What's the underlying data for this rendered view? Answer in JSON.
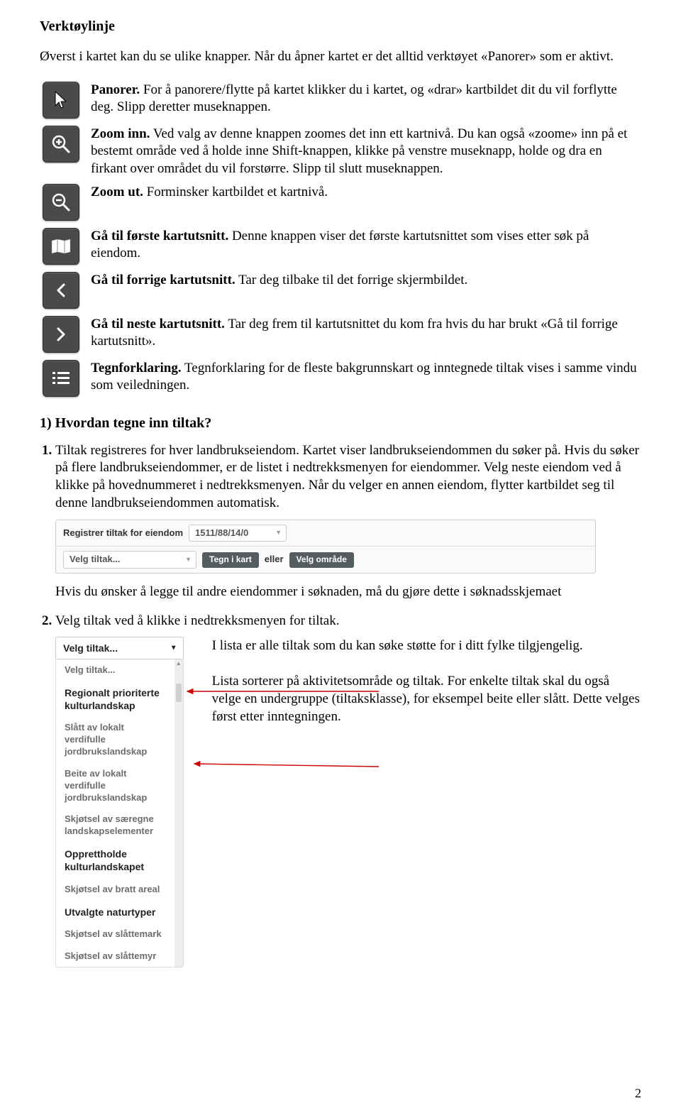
{
  "title": "Verktøylinje",
  "intro": "Øverst i kartet kan du se ulike knapper. Når du åpner kartet er det alltid verktøyet «Panorer» som er aktivt.",
  "tools": [
    {
      "name": "Panorer.",
      "text": " For å panorere/flytte på kartet klikker du i kartet, og «drar» kartbildet dit du vil forflytte deg. Slipp deretter museknappen."
    },
    {
      "name": "Zoom inn.",
      "text": " Ved valg av denne knappen zoomes det inn ett kartnivå. Du kan også «zoome» inn på et bestemt område ved å holde inne Shift-knappen, klikke på venstre museknapp, holde og dra en firkant over området du vil forstørre. Slipp til slutt museknappen."
    },
    {
      "name": "Zoom ut.",
      "text": " Forminsker kartbildet et kartnivå."
    },
    {
      "name": "Gå til første kartutsnitt.",
      "text": " Denne knappen viser det første kartutsnittet som vises etter søk på eiendom."
    },
    {
      "name": "Gå til forrige kartutsnitt.",
      "text": " Tar deg tilbake til det forrige skjermbildet."
    },
    {
      "name": "Gå til neste kartutsnitt.",
      "text": " Tar deg frem til kartutsnittet du kom fra hvis du har brukt «Gå til forrige kartutsnitt»."
    },
    {
      "name": "Tegnforklaring.",
      "text": " Tegnforklaring for de fleste bakgrunnskart og inntegnede tiltak vises i samme vindu som veiledningen."
    }
  ],
  "section1_heading": "1)  Hvordan tegne inn tiltak?",
  "step1_num": "1.",
  "step1_text": "Tiltak registreres for hver landbrukseiendom. Kartet viser landbrukseiendommen du søker på. Hvis du søker på flere landbrukseiendommer, er de listet i nedtrekksmenyen for eiendommer. Velg neste eiendom ved å klikke på hovednummeret i nedtrekksmenyen. Når du velger en annen eiendom, flytter kartbildet seg til denne landbrukseiendommen automatisk.",
  "fig1": {
    "label": "Registrer tiltak for eiendom",
    "eiendom_value": "1511/88/14/0",
    "velg_tiltak": "Velg tiltak...",
    "tegn_kart": "Tegn i kart",
    "eller": "eller",
    "velg_omrade": "Velg område"
  },
  "after_fig1": "Hvis du ønsker å legge til andre eiendommer i søknaden, må du gjøre dette i søknadsskjemaet",
  "step2_num": "2.",
  "step2_text": "Velg tiltak ved å klikke i nedtrekksmenyen for tiltak.",
  "fig2": {
    "header": "Velg tiltak...",
    "group_hint": "Velg tiltak...",
    "groups": [
      {
        "title": "Regionalt prioriterte kulturlandskap",
        "items": [
          "Slått av lokalt verdifulle jordbrukslandskap",
          "Beite av lokalt verdifulle jordbrukslandskap",
          "Skjøtsel av særegne landskapselementer"
        ]
      },
      {
        "title": "Opprettholde kulturlandskapet",
        "items": [
          "Skjøtsel av bratt areal"
        ]
      },
      {
        "title": "Utvalgte naturtyper",
        "items": [
          "Skjøtsel av slåttemark",
          "Skjøtsel av slåttemyr"
        ]
      }
    ]
  },
  "side_text": {
    "p1": "I lista er alle tiltak som du kan søke støtte for i ditt fylke tilgjengelig.",
    "p2": "Lista sorterer på aktivitetsområde og tiltak. For enkelte tiltak skal du også velge en undergruppe (tiltaksklasse), for eksempel beite eller slått. Dette velges først etter inntegningen."
  },
  "page_number": "2"
}
